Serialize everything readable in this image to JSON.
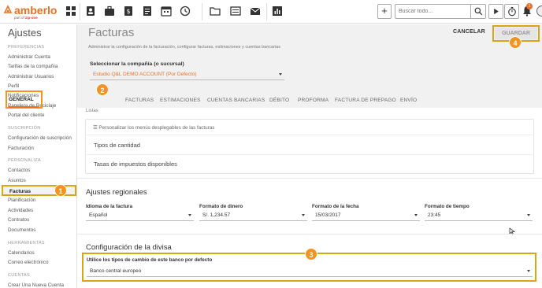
{
  "brand": {
    "name": "amberlo",
    "tagline": "part of",
    "tagline_partner": "zip-one",
    "color": "#f26d21"
  },
  "topbar": {
    "icons": [
      "dashboard-icon",
      "contacts-icon",
      "cases-icon",
      "billing-icon",
      "invoice-icon",
      "calendar-icon",
      "time-icon",
      "folder-icon",
      "documents-icon",
      "mail-icon",
      "reports-icon"
    ],
    "search_placeholder": "Buscar todo...",
    "notification_count": "1"
  },
  "sidebar": {
    "title": "Ajustes",
    "sections": [
      {
        "heading": "PREFERENCIAS",
        "items": [
          "Administrar Cuenta",
          "Tarifas de la compañía",
          "Administrar Usuarios",
          "Perfil",
          "Notificaciones",
          "Papelera de Reciclaje",
          "Portal del cliente"
        ]
      },
      {
        "heading": "SUSCRIPCIÓN",
        "items": [
          "Configuración de suscripción",
          "Facturación"
        ]
      },
      {
        "heading": "PERSONALIZA",
        "items": [
          "Contactos",
          "Asuntos",
          "Facturas",
          "Planificación",
          "Actividades",
          "Contratos",
          "Documentos"
        ]
      },
      {
        "heading": "HERRAMIENTAS",
        "items": [
          "Calendarios",
          "Correo electrónico"
        ]
      },
      {
        "heading": "CUENTAS",
        "items": [
          "Crear Una Nueva Cuenta"
        ]
      }
    ],
    "active_item": "Facturas"
  },
  "markers": [
    "1",
    "2",
    "3",
    "4"
  ],
  "header": {
    "title": "Facturas",
    "subtitle": "Administrar la configuración de la facturación, configurar facturas, estimaciones y cuentas bancarias",
    "cancel_label": "CANCELAR",
    "save_label": "GUARDAR"
  },
  "company": {
    "label": "Seleccionar la compañía (o sucursal)",
    "value": "Estudio Q&L DEMO ACCOUNT (Por Defecto)"
  },
  "tabs": [
    "GENERAL",
    "FACTURAS",
    "ESTIMACIONES",
    "CUENTAS BANCARIAS",
    "DÉBITO",
    "PROFORMA",
    "FACTURA DE PREPAGO",
    "ENVÍO"
  ],
  "lists": {
    "heading": "Listas",
    "customize_label": "Personalizar los menús desplegables de las facturas",
    "rows": [
      "Tipos de cantidad",
      "Tasas de impuestos disponibles"
    ]
  },
  "regional": {
    "title": "Ajustes regionales",
    "fields": [
      {
        "label": "Idioma de la factura",
        "value": "Español"
      },
      {
        "label": "Formato de dinero",
        "value": "S/. 1,234.57"
      },
      {
        "label": "Formato de la fecha",
        "value": "15/03/2017"
      },
      {
        "label": "Formato de tiempo",
        "value": "23:45"
      }
    ]
  },
  "currency": {
    "title": "Configuración de la divisa",
    "label": "Utilice los tipos de cambio de este banco por defecto",
    "value": "Banco central europeo"
  }
}
